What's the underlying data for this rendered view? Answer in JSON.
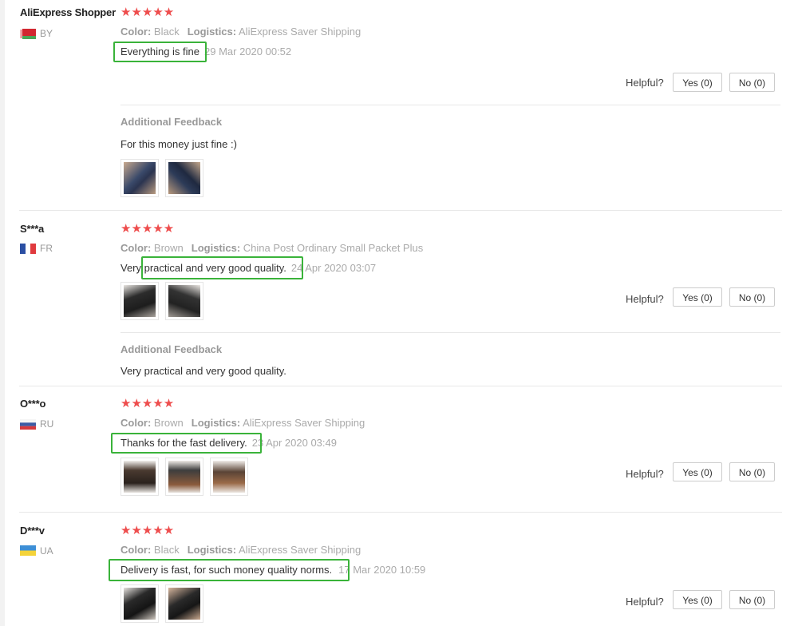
{
  "labels": {
    "color_key": "Color:",
    "logistics_key": "Logistics:",
    "helpful": "Helpful?",
    "additional_feedback": "Additional Feedback"
  },
  "reviews": [
    {
      "name": "AliExpress Shopper",
      "country": "BY",
      "stars": "★★★★★",
      "color": "Black",
      "logistics": "AliExpress Saver Shipping",
      "text": "Everything is fine",
      "date": "29 Mar 2020 00:52",
      "yes": "Yes (0)",
      "no": "No (0)",
      "additional": "For this money just fine :)"
    },
    {
      "name": "S***a",
      "country": "FR",
      "stars": "★★★★★",
      "color": "Brown",
      "logistics": "China Post Ordinary Small Packet Plus",
      "text_prefix": "Very ",
      "text": "practical and very good quality.",
      "date": "24 Apr 2020 03:07",
      "yes": "Yes (0)",
      "no": "No (0)",
      "additional": "Very practical and very good quality."
    },
    {
      "name": "O***o",
      "country": "RU",
      "stars": "★★★★★",
      "color": "Brown",
      "logistics": "AliExpress Saver Shipping",
      "text": "Thanks for the fast delivery.",
      "date": "23 Apr 2020 03:49",
      "yes": "Yes (0)",
      "no": "No (0)"
    },
    {
      "name": "D***v",
      "country": "UA",
      "stars": "★★★★★",
      "color": "Black",
      "logistics": "AliExpress Saver Shipping",
      "text": "Delivery is fast, for such money quality norms.",
      "date": "17 Mar 2020 10:59",
      "yes": "Yes (0)",
      "no": "No (0)"
    }
  ],
  "colors": {
    "star": "#ee4d4d",
    "highlight_box": "#3ab33a"
  }
}
